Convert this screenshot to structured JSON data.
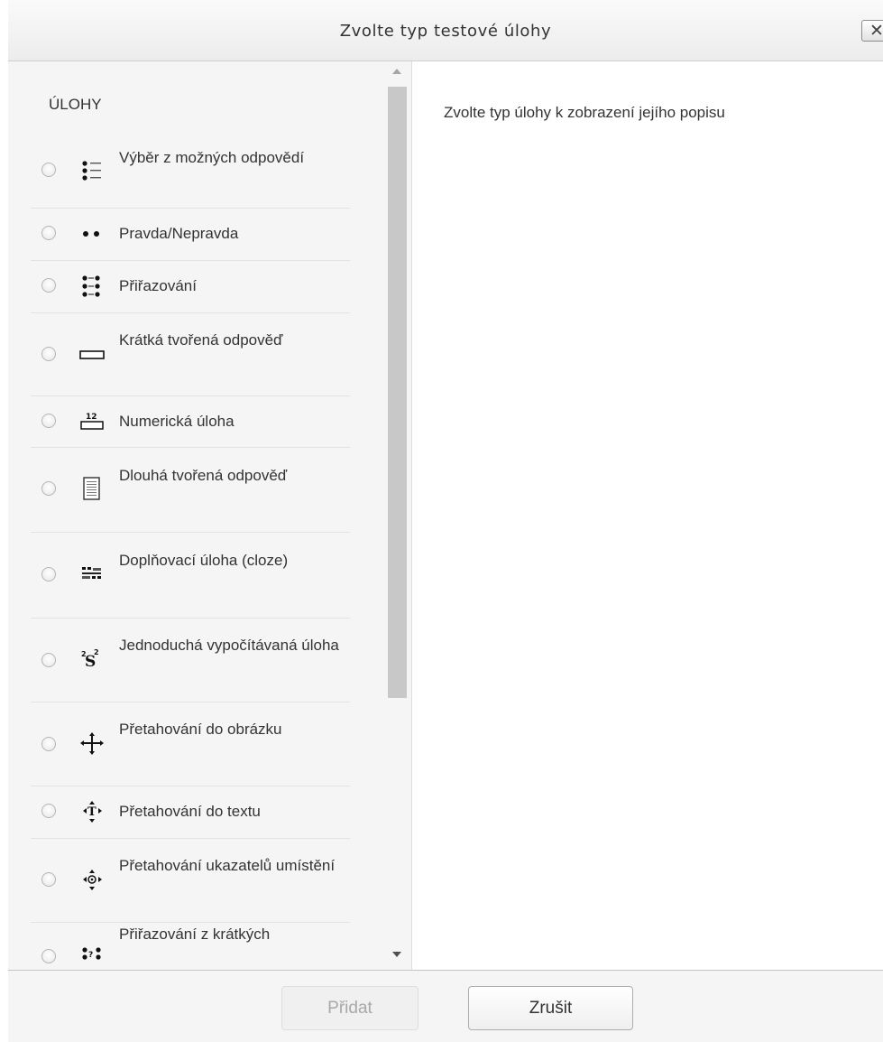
{
  "dialog": {
    "title": "Zvolte typ testové úlohy",
    "close_glyph": "✕"
  },
  "left": {
    "heading": "ÚLOHY",
    "items": [
      {
        "label": "Výběr z možných odpovědí",
        "icon": "multichoice-icon",
        "selected": false
      },
      {
        "label": "Pravda/Nepravda",
        "icon": "truefalse-icon",
        "selected": false
      },
      {
        "label": "Přiřazování",
        "icon": "match-icon",
        "selected": false
      },
      {
        "label": "Krátká tvořená odpověď",
        "icon": "shortanswer-icon",
        "selected": false
      },
      {
        "label": "Numerická úloha",
        "icon": "numerical-icon",
        "selected": false
      },
      {
        "label": "Dlouhá tvořená odpověď",
        "icon": "essay-icon",
        "selected": false
      },
      {
        "label": "Doplňovací úloha (cloze)",
        "icon": "cloze-icon",
        "selected": false
      },
      {
        "label": "Jednoduchá vypočítávaná úloha",
        "icon": "calculated-simple-icon",
        "selected": false
      },
      {
        "label": "Přetahování do obrázku",
        "icon": "drag-drop-image-icon",
        "selected": false
      },
      {
        "label": "Přetahování do textu",
        "icon": "drag-drop-text-icon",
        "selected": false
      },
      {
        "label": "Přetahování ukazatelů umístění",
        "icon": "drag-drop-markers-icon",
        "selected": false
      },
      {
        "label": "Přiřazování z krátkých",
        "icon": "random-short-match-icon",
        "selected": false
      }
    ]
  },
  "right": {
    "hint": "Zvolte typ úlohy k zobrazení jejího popisu"
  },
  "footer": {
    "add_label": "Přidat",
    "cancel_label": "Zrušit"
  },
  "colors": {
    "pane_bg": "#f5f5f5",
    "disabled_text": "#a8a8a8"
  }
}
